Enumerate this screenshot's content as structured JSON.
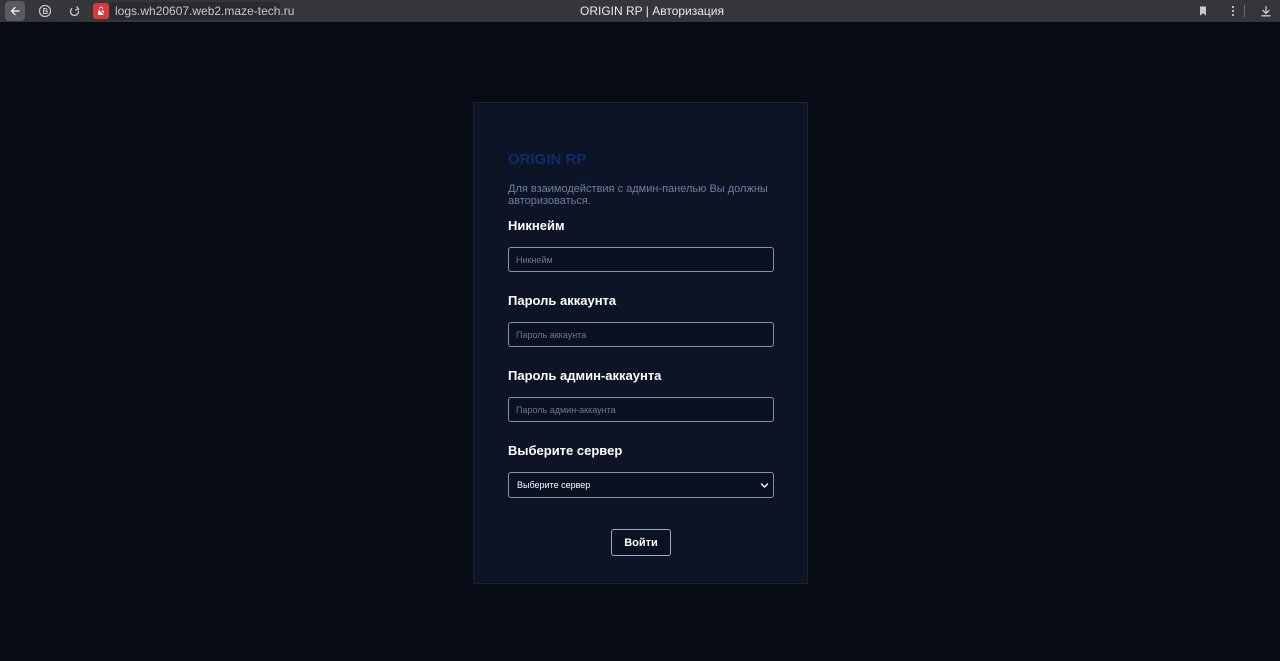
{
  "browser": {
    "url": "logs.wh20607.web2.maze-tech.ru",
    "tab_title": "ORIGIN RP | Авторизация",
    "icons": [
      "back-arrow-icon",
      "extension-icon",
      "reload-icon",
      "site-badge-icon",
      "bookmark-icon",
      "menu-dots-icon",
      "download-icon"
    ]
  },
  "login": {
    "brand": "ORIGIN RP",
    "subtitle": "Для взаимодействия с админ-панелью Вы должны авторизоваться.",
    "nickname": {
      "label": "Никнейм",
      "placeholder": "Никнейм",
      "value": ""
    },
    "account_password": {
      "label": "Пароль аккаунта",
      "placeholder": "Пароль аккаунта",
      "value": ""
    },
    "admin_password": {
      "label": "Пароль админ-аккаунта",
      "placeholder": "Пароль админ-аккаунта",
      "value": ""
    },
    "server": {
      "label": "Выберите сервер",
      "selected": "Выберите сервер"
    },
    "submit_label": "Войти"
  },
  "colors": {
    "page_bg": "#070b14",
    "card_bg": "#0c1426",
    "brand": "#0e2b6b",
    "subtitle": "#6f7f9c",
    "field_border": "#8a93a6",
    "site_badge": "#d93a3a"
  }
}
